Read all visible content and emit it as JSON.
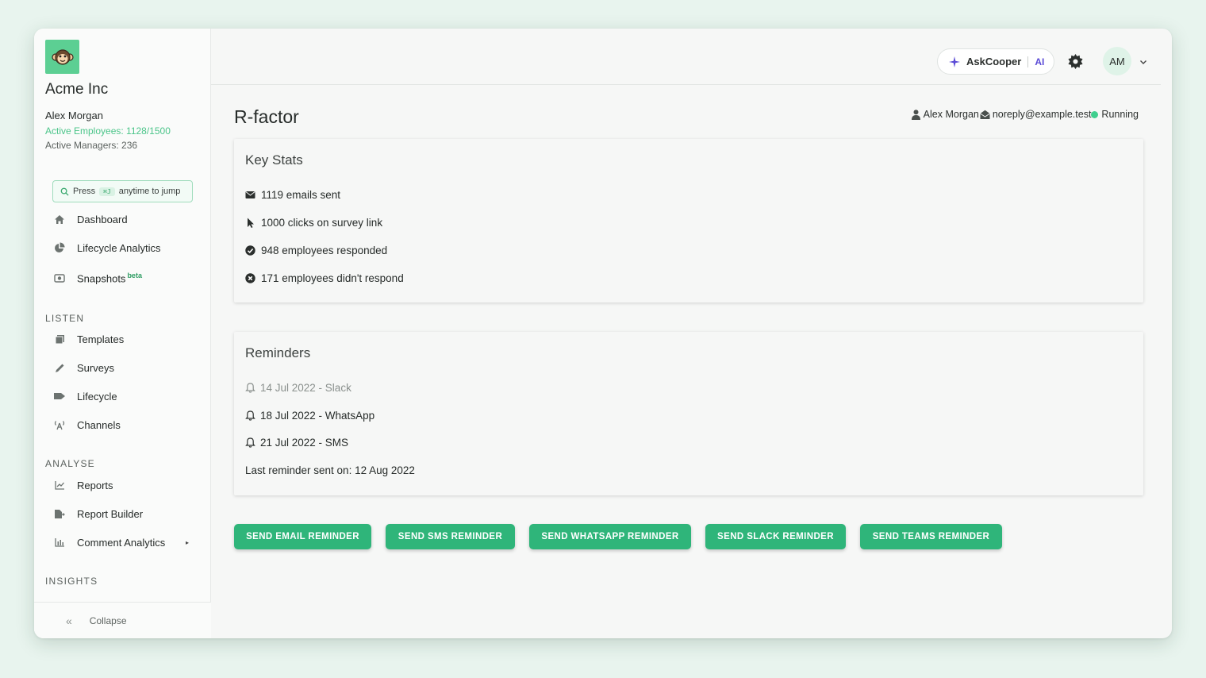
{
  "sidebar": {
    "company": "Acme Inc",
    "user_name": "Alex Morgan",
    "active_employees": "Active Employees: 1128/1500",
    "active_managers": "Active Managers: 236",
    "jump": {
      "press": "Press",
      "shortcut": "⌘J",
      "suffix": "anytime to jump"
    },
    "main_items": [
      {
        "label": "Dashboard",
        "icon": "home-icon"
      },
      {
        "label": "Lifecycle Analytics",
        "icon": "pie-chart-icon"
      },
      {
        "label": "Snapshots",
        "badge": "beta",
        "icon": "camera-icon"
      }
    ],
    "listen_label": "LISTEN",
    "listen_items": [
      {
        "label": "Templates",
        "icon": "copy-icon"
      },
      {
        "label": "Surveys",
        "icon": "pen-icon"
      },
      {
        "label": "Lifecycle",
        "icon": "flag-icon"
      },
      {
        "label": "Channels",
        "icon": "broadcast-icon"
      }
    ],
    "analyse_label": "ANALYSE",
    "analyse_items": [
      {
        "label": "Reports",
        "icon": "line-chart-icon"
      },
      {
        "label": "Report Builder",
        "icon": "file-export-icon"
      },
      {
        "label": "Comment Analytics",
        "icon": "bar-chart-icon"
      }
    ],
    "insights_label": "INSIGHTS",
    "collapse_label": "Collapse"
  },
  "header": {
    "ask_label": "AskCooper",
    "ask_badge": "AI",
    "avatar_initials": "AM"
  },
  "page": {
    "title": "R-factor",
    "owner": "Alex Morgan",
    "email": "noreply@example.test",
    "status": "Running",
    "status_color": "#3fcf8e"
  },
  "key_stats": {
    "title": "Key Stats",
    "items": [
      "1119 emails sent",
      "1000 clicks on survey link",
      "948 employees responded",
      "171 employees didn't respond"
    ]
  },
  "reminders": {
    "title": "Reminders",
    "items": [
      "14 Jul 2022 - Slack",
      "18 Jul 2022 - WhatsApp",
      "21 Jul 2022 - SMS"
    ],
    "last_sent": "Last reminder sent on: 12 Aug 2022"
  },
  "actions": {
    "email": "SEND EMAIL REMINDER",
    "sms": "SEND SMS REMINDER",
    "whatsapp": "SEND WHATSAPP REMINDER",
    "slack": "SEND SLACK REMINDER",
    "teams": "SEND TEAMS REMINDER"
  },
  "colors": {
    "accent": "#2fb57a",
    "brand": "#5ccf93",
    "ai": "#5b4bd6"
  }
}
